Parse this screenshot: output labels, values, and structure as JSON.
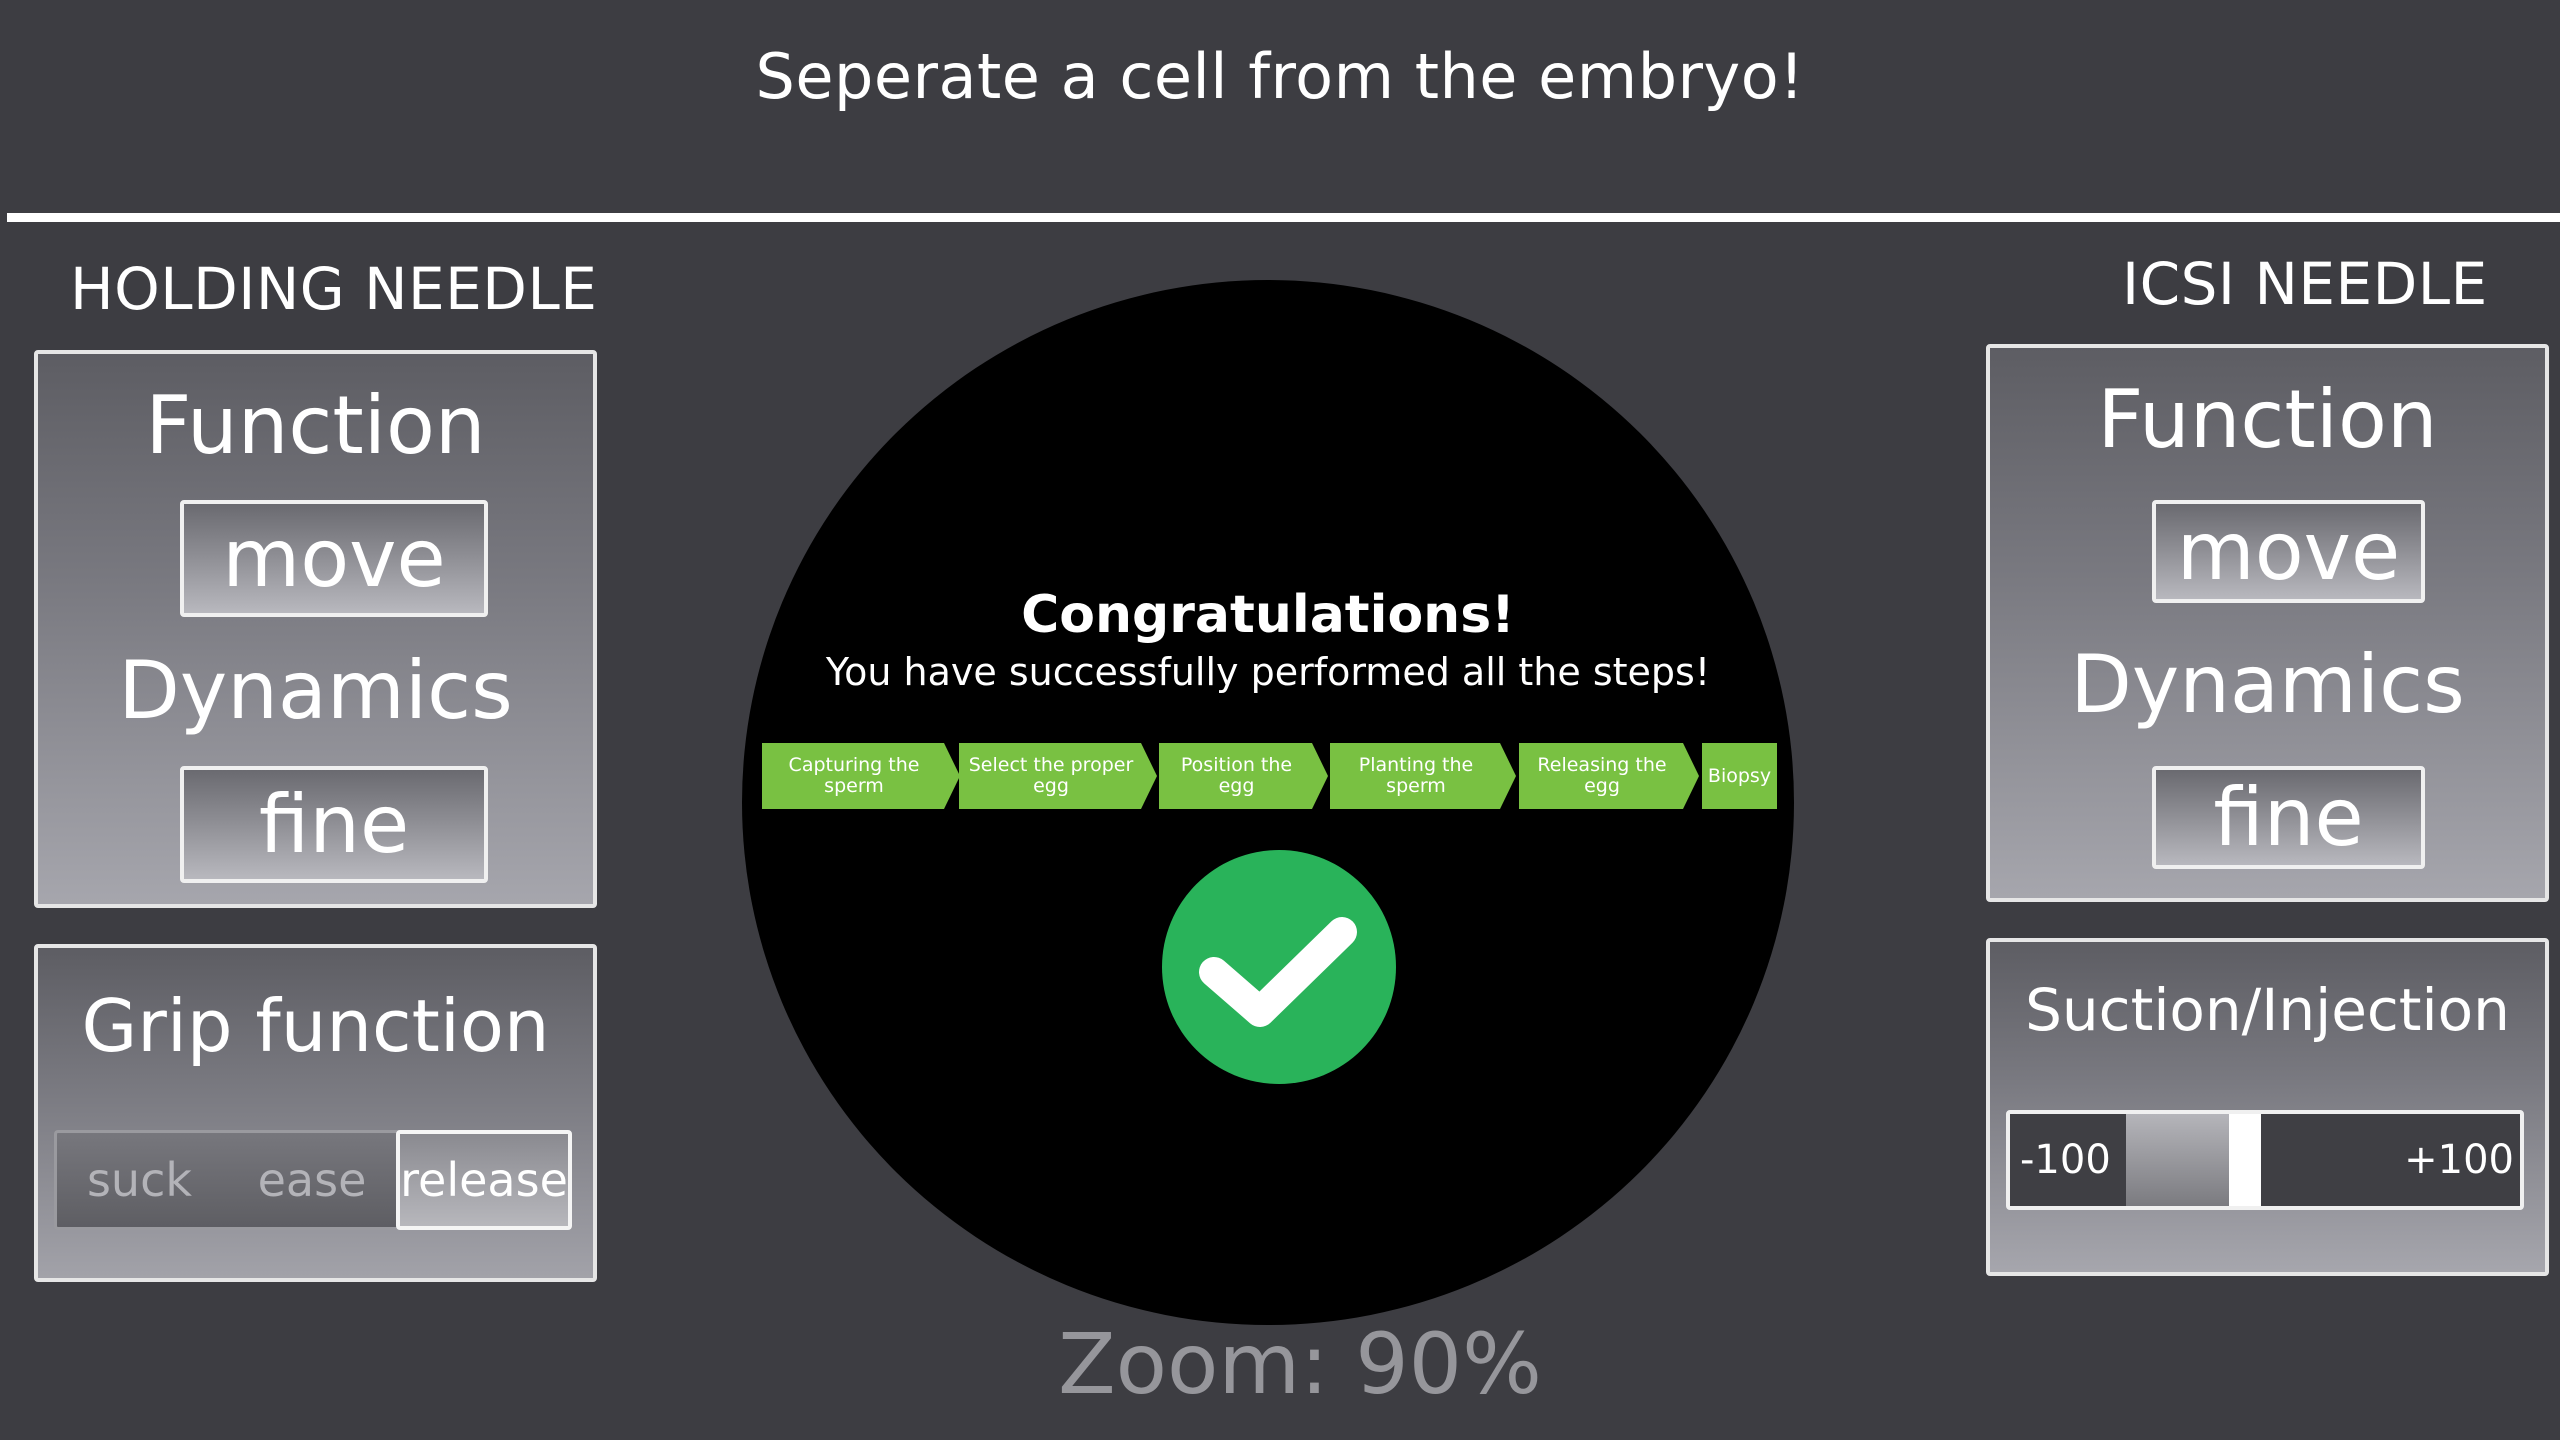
{
  "header": {
    "title": "Seperate a cell from the embryo!"
  },
  "holding_needle": {
    "title": "HOLDING NEEDLE",
    "function_label": "Function",
    "function_value": "move",
    "dynamics_label": "Dynamics",
    "dynamics_value": "fine",
    "grip": {
      "label": "Grip function",
      "options": [
        "suck",
        "ease",
        "release"
      ],
      "selected": "release"
    }
  },
  "icsi_needle": {
    "title": "ICSI NEEDLE",
    "function_label": "Function",
    "function_value": "move",
    "dynamics_label": "Dynamics",
    "dynamics_value": "fine",
    "suction": {
      "label": "Suction/Injection",
      "min_label": "-100",
      "max_label": "+100",
      "min": -100,
      "max": 100,
      "value": -8
    }
  },
  "scope": {
    "congrats_title": "Congratulations!",
    "congrats_subtitle": "You have successfully performed all the steps!",
    "steps": [
      "Capturing the sperm",
      "Select the proper egg",
      "Position the egg",
      "Planting the sperm",
      "Releasing the egg",
      "Biopsy"
    ],
    "step_color": "#79c142",
    "check_color": "#29b35a",
    "completed_icon": "check-icon"
  },
  "footer": {
    "zoom_text": "Zoom: 90%"
  }
}
